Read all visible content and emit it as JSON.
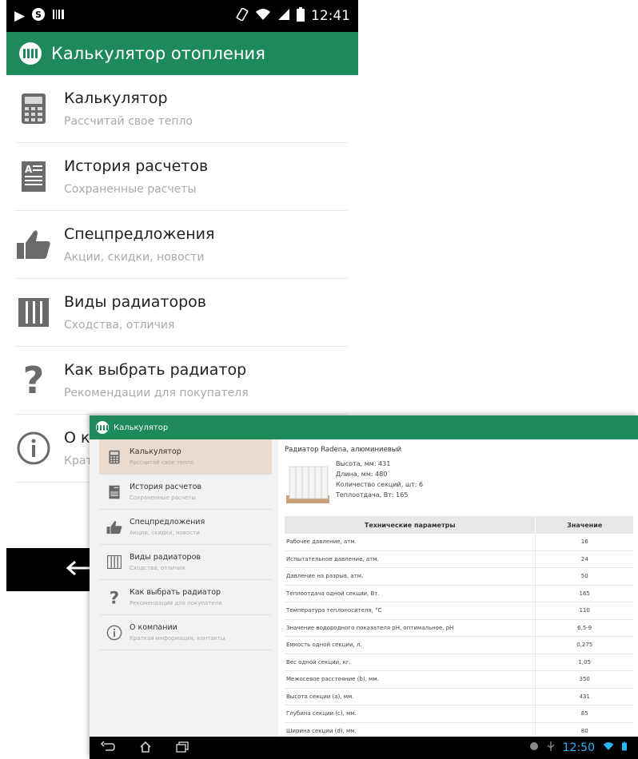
{
  "phone": {
    "status": {
      "time": "12:41"
    },
    "app_title": "Калькулятор отопления",
    "menu": [
      {
        "title": "Калькулятор",
        "subtitle": "Рассчитай свое тепло",
        "icon": "calculator-icon"
      },
      {
        "title": "История расчетов",
        "subtitle": "Сохраненные расчеты",
        "icon": "document-icon"
      },
      {
        "title": "Спецпредложения",
        "subtitle": "Акции, скидки, новости",
        "icon": "thumbs-up-icon"
      },
      {
        "title": "Виды радиаторов",
        "subtitle": "Сходства, отличия",
        "icon": "radiator-icon"
      },
      {
        "title": "Как выбрать радиатор",
        "subtitle": "Рекомендации для покупателя",
        "icon": "question-icon"
      },
      {
        "title": "О к",
        "subtitle": "Крат",
        "icon": "info-icon"
      }
    ]
  },
  "tablet": {
    "app_title": "Калькулятор",
    "menu": [
      {
        "title": "Калькулятор",
        "subtitle": "Рассчитай свое тепло",
        "icon": "calculator-icon",
        "active": true
      },
      {
        "title": "История расчетов",
        "subtitle": "Сохраненные расчеты",
        "icon": "document-icon"
      },
      {
        "title": "Спецпредложения",
        "subtitle": "Акции, скидки, новости",
        "icon": "thumbs-up-icon"
      },
      {
        "title": "Виды радиаторов",
        "subtitle": "Сходства, отличия",
        "icon": "radiator-icon"
      },
      {
        "title": "Как выбрать радиатор",
        "subtitle": "Рекомендации для покупателя",
        "icon": "question-icon"
      },
      {
        "title": "О компании",
        "subtitle": "Краткая информация, контакты",
        "icon": "info-icon"
      }
    ],
    "product": {
      "title": "Радиатор Radena, алюминиевый",
      "specs": [
        "Высота, мм: 431",
        "Длина, мм: 480",
        "Количество секций, шт: 6",
        "Теплоотдача, Вт: 165"
      ]
    },
    "table": {
      "headers": [
        "Технические параметры",
        "Значение"
      ],
      "rows": [
        [
          "Рабочее давление, атм.",
          "16"
        ],
        [
          "Испытательное давление, атм.",
          "24"
        ],
        [
          "Давление на разрыв, атм.",
          "50"
        ],
        [
          "Теплоотдача одной секции, Вт.",
          "165"
        ],
        [
          "Температура теплоносителя, °С",
          "110"
        ],
        [
          "Значение водородного показателя pH, оптимальное, pH",
          "6,5-9"
        ],
        [
          "Емкость одной секции, л.",
          "0,275"
        ],
        [
          "Вес одной секции, кг.",
          "1,05"
        ],
        [
          "Межосевое расстояние (b), мм.",
          "350"
        ],
        [
          "Высота секции (a), мм.",
          "431"
        ],
        [
          "Глубина секции (c), мм.",
          "85"
        ],
        [
          "Ширина секции (d), мм.",
          "80"
        ]
      ]
    },
    "status": {
      "time": "12:50"
    }
  },
  "colors": {
    "accent": "#1e8a5c",
    "active_item": "#eadbd0",
    "clock_blue": "#29b6f6"
  }
}
